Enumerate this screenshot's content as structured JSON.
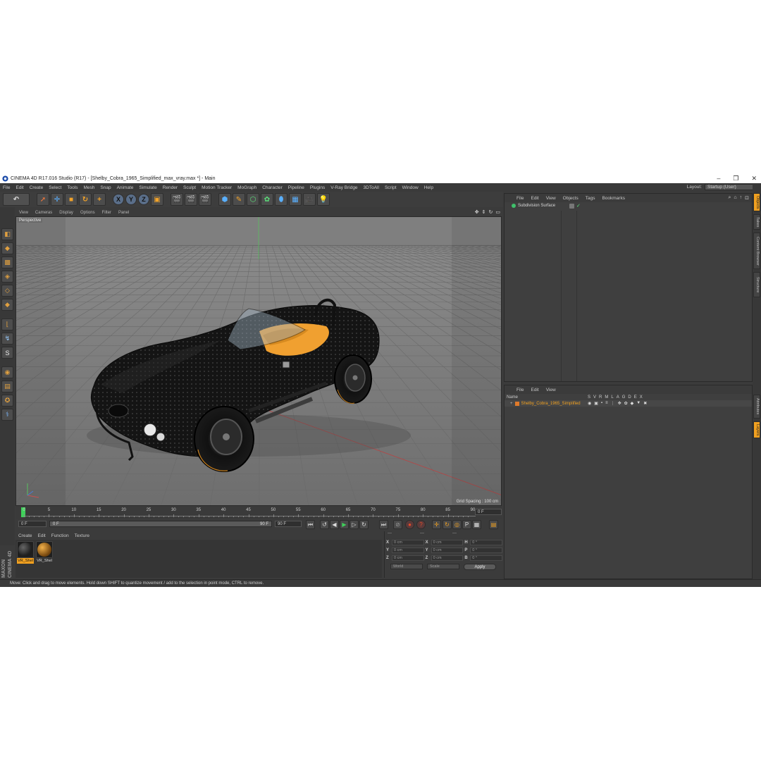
{
  "window": {
    "title": "CINEMA 4D R17.016 Studio (R17) - [Shelby_Cobra_1965_Simplified_max_vray.max *] - Main",
    "minimize": "–",
    "restore": "❐",
    "close": "✕"
  },
  "menu": {
    "items": [
      "File",
      "Edit",
      "Create",
      "Select",
      "Tools",
      "Mesh",
      "Snap",
      "Animate",
      "Simulate",
      "Render",
      "Sculpt",
      "Motion Tracker",
      "MoGraph",
      "Character",
      "Pipeline",
      "Plugins",
      "V-Ray Bridge",
      "3DToAll",
      "Script",
      "Window",
      "Help"
    ],
    "layout_label": "Layout:",
    "layout_value": "Startup (User)"
  },
  "toolbar": {
    "icons": [
      "undo-icon",
      "select-icon",
      "move-icon",
      "scale-icon",
      "rotate-icon",
      "add-icon",
      "x-axis-icon",
      "y-axis-icon",
      "z-axis-icon",
      "coord-system-icon",
      "render-view-icon",
      "render-picture-queue-icon",
      "render-settings-icon",
      "cube-icon",
      "pen-icon",
      "subdivision-icon",
      "array-icon",
      "deformer-icon",
      "floor-icon",
      "camera-icon",
      "light-icon"
    ],
    "axis_x": "X",
    "axis_y": "Y",
    "axis_z": "Z"
  },
  "viewport": {
    "menu": [
      "View",
      "Cameras",
      "Display",
      "Options",
      "Filter",
      "Panel"
    ],
    "label": "Perspective",
    "grid_spacing": "Grid Spacing : 100 cm",
    "background": "#7d7d7d"
  },
  "timeline": {
    "ticks": [
      "0",
      "5",
      "10",
      "15",
      "20",
      "25",
      "30",
      "35",
      "40",
      "45",
      "50",
      "55",
      "60",
      "65",
      "70",
      "75",
      "80",
      "85",
      "90"
    ],
    "current_frame": "0 F",
    "start_field": "0 F",
    "slider_start": "0 F",
    "slider_end": "90 F",
    "end_field": "90 F",
    "accent": "#3fd15a"
  },
  "materials": {
    "menu": [
      "Create",
      "Edit",
      "Function",
      "Texture"
    ],
    "items": [
      {
        "label": "VR_Shel",
        "selected": true
      },
      {
        "label": "VR_Shel",
        "selected": false
      }
    ]
  },
  "coordinates": {
    "headers": [
      "—",
      "—",
      "—"
    ],
    "rows": [
      {
        "a1": "X",
        "v1": "0 cm",
        "a2": "X",
        "v2": "0 cm",
        "a3": "H",
        "v3": "0 °"
      },
      {
        "a1": "Y",
        "v1": "0 cm",
        "a2": "Y",
        "v2": "0 cm",
        "a3": "P",
        "v3": "0 °"
      },
      {
        "a1": "Z",
        "v1": "0 cm",
        "a2": "Z",
        "v2": "0 cm",
        "a3": "B",
        "v3": "0 °"
      }
    ],
    "mode_dropdown": "World",
    "size_dropdown": "Scale",
    "apply_label": "Apply"
  },
  "status": {
    "text": "Move: Click and drag to move elements. Hold down SHIFT to quantize movement / add to the selection in point mode, CTRL to remove."
  },
  "object_manager": {
    "menu": [
      "File",
      "Edit",
      "View",
      "Objects",
      "Tags",
      "Bookmarks"
    ],
    "objects": [
      {
        "name": "Subdivision Surface"
      }
    ]
  },
  "layer_manager": {
    "menu": [
      "File",
      "Edit",
      "View"
    ],
    "name_header": "Name",
    "column_headers": [
      "S",
      "V",
      "R",
      "M",
      "L",
      "A",
      "G",
      "D",
      "E",
      "X"
    ],
    "layers": [
      {
        "name": "Shelby_Cobra_1965_Simplified",
        "color": "#e07a2a"
      }
    ]
  },
  "right_tabs": [
    "Objects",
    "Takes",
    "Content Browser",
    "Structure",
    "Attributes",
    "Layers"
  ],
  "branding": {
    "logo": "MAXON CINEMA 4D"
  }
}
